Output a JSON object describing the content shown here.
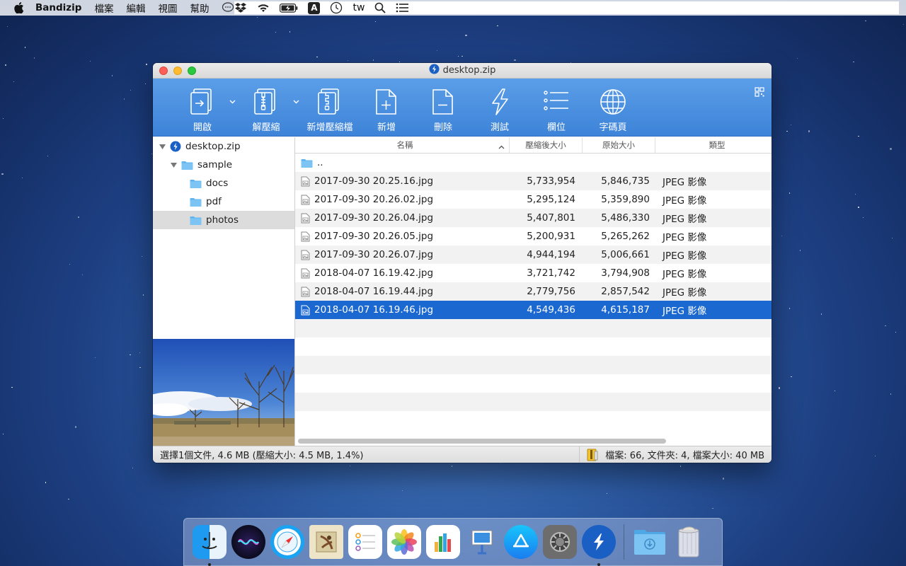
{
  "menubar": {
    "app_name": "Bandizip",
    "items": [
      "檔案",
      "編輯",
      "視圖",
      "幫助"
    ],
    "input_indicator": "A",
    "locale": "tw"
  },
  "window": {
    "title": "desktop.zip"
  },
  "toolbar": {
    "open": "開啟",
    "extract": "解壓縮",
    "new_archive": "新增壓縮檔",
    "add": "新增",
    "delete": "刪除",
    "test": "測試",
    "columns": "欄位",
    "codepage": "字碼頁"
  },
  "tree": {
    "root": "desktop.zip",
    "sample": "sample",
    "docs": "docs",
    "pdf": "pdf",
    "photos": "photos"
  },
  "columns": {
    "name": "名稱",
    "compressed": "壓縮後大小",
    "original": "原始大小",
    "type": "類型"
  },
  "parent_dir": "..",
  "files": [
    {
      "name": "2017-09-30 20.25.16.jpg",
      "compressed": "5,733,954",
      "original": "5,846,735",
      "type": "JPEG 影像"
    },
    {
      "name": "2017-09-30 20.26.02.jpg",
      "compressed": "5,295,124",
      "original": "5,359,890",
      "type": "JPEG 影像"
    },
    {
      "name": "2017-09-30 20.26.04.jpg",
      "compressed": "5,407,801",
      "original": "5,486,330",
      "type": "JPEG 影像"
    },
    {
      "name": "2017-09-30 20.26.05.jpg",
      "compressed": "5,200,931",
      "original": "5,265,262",
      "type": "JPEG 影像"
    },
    {
      "name": "2017-09-30 20.26.07.jpg",
      "compressed": "4,944,194",
      "original": "5,006,661",
      "type": "JPEG 影像"
    },
    {
      "name": "2018-04-07 16.19.42.jpg",
      "compressed": "3,721,742",
      "original": "3,794,908",
      "type": "JPEG 影像"
    },
    {
      "name": "2018-04-07 16.19.44.jpg",
      "compressed": "2,779,756",
      "original": "2,857,542",
      "type": "JPEG 影像"
    },
    {
      "name": "2018-04-07 16.19.46.jpg",
      "compressed": "4,549,436",
      "original": "4,615,187",
      "type": "JPEG 影像"
    }
  ],
  "status": {
    "selection": "選擇1個文件, 4.6 MB (壓縮大小: 4.5 MB, 1.4%)",
    "summary": "檔案: 66, 文件夾: 4, 檔案大小: 40 MB"
  },
  "colors": {
    "toolbar": "#4a90e2",
    "selection": "#1b68d1",
    "folder": "#5eb3ef"
  },
  "dock": [
    "finder-icon",
    "siri-icon",
    "safari-icon",
    "mail-icon",
    "reminders-icon",
    "photos-icon",
    "numbers-icon",
    "keynote-icon",
    "app-store-icon",
    "system-preferences-icon",
    "bandizip-icon",
    "downloads-icon",
    "trash-icon"
  ]
}
